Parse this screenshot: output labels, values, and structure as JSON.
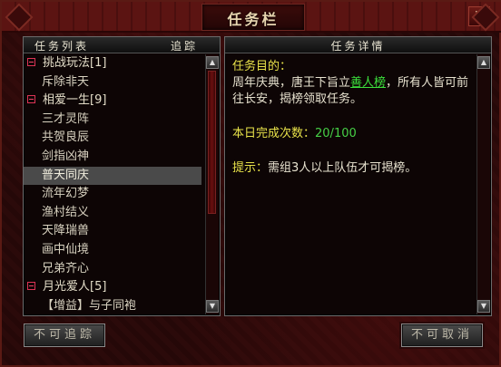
{
  "window": {
    "title": "任务栏",
    "close": "✕"
  },
  "left_panel": {
    "header_left": "任务列表",
    "header_right": "追踪",
    "rows": [
      {
        "label": "挑战玩法[1]",
        "type": "group"
      },
      {
        "label": "斥除非天",
        "type": "child"
      },
      {
        "label": "相爱一生[9]",
        "type": "group"
      },
      {
        "label": "三才灵阵",
        "type": "child"
      },
      {
        "label": "共贺良辰",
        "type": "child"
      },
      {
        "label": "剑指凶神",
        "type": "child"
      },
      {
        "label": "普天同庆",
        "type": "child",
        "selected": true
      },
      {
        "label": "流年幻梦",
        "type": "child"
      },
      {
        "label": "渔村结义",
        "type": "child"
      },
      {
        "label": "天降瑞兽",
        "type": "child"
      },
      {
        "label": "画中仙境",
        "type": "child"
      },
      {
        "label": "兄弟齐心",
        "type": "child"
      },
      {
        "label": "月光爱人[5]",
        "type": "group"
      },
      {
        "label": "【增益】与子同袍",
        "type": "child"
      }
    ]
  },
  "right_panel": {
    "header": "任务详情",
    "objective_label": "任务目的：",
    "objective_text_1": "周年庆典，唐王下旨立",
    "objective_link": "善人榜",
    "objective_text_2": "，所有人皆可前往长安，揭榜领取任务。",
    "daily_label": "本日完成次数：",
    "daily_value": "20/100",
    "tip_label": "提示：",
    "tip_text": "需组3人以上队伍才可揭榜。"
  },
  "buttons": {
    "track": "不可追踪",
    "cancel": "不可取消"
  },
  "colors": {
    "highlight_yellow": "#e8e24a",
    "highlight_green": "#46d046",
    "selected_row": "#4a4a4a"
  }
}
